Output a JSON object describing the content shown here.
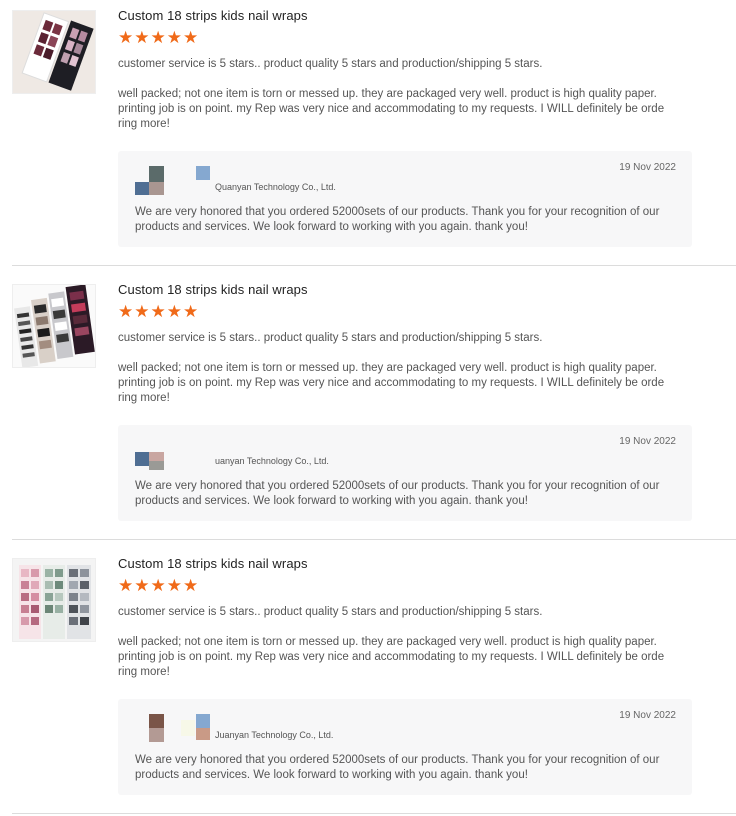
{
  "reviews": [
    {
      "product_title": "Custom 18 strips kids nail wraps",
      "rating": 5,
      "comment_line1": "customer service is 5 stars.. product quality 5 stars and production/shipping 5 stars.",
      "comment_body": "well packed; not one item is torn or messed up. they are packaged very well. product is high quality paper. printing job is on point. my Rep was very nice and accommodating to my requests. I WILL definitely be ordering more!",
      "reply": {
        "date": "19 Nov 2022",
        "company": "Quanyan Technology Co., Ltd.",
        "text": "We are very honored that you ordered 52000sets of our products. Thank you for your recognition of our products and services. We look forward to working with you again. thank you!"
      }
    },
    {
      "product_title": "Custom 18 strips kids nail wraps",
      "rating": 5,
      "comment_line1": "customer service is 5 stars.. product quality 5 stars and production/shipping 5 stars.",
      "comment_body": "well packed; not one item is torn or messed up. they are packaged very well. product is high quality paper. printing job is on point. my Rep was very nice and accommodating to my requests. I WILL definitely be ordering more!",
      "reply": {
        "date": "19 Nov 2022",
        "company": "uanyan Technology Co., Ltd.",
        "text": "We are very honored that you ordered 52000sets of our products. Thank you for your recognition of our products and services. We look forward to working with you again. thank you!"
      }
    },
    {
      "product_title": "Custom 18 strips kids nail wraps",
      "rating": 5,
      "comment_line1": "customer service is 5 stars.. product quality 5 stars and production/shipping 5 stars.",
      "comment_body": "well packed; not one item is torn or messed up. they are packaged very well. product is high quality paper. printing job is on point. my Rep was very nice and accommodating to my requests. I WILL definitely be ordering more!",
      "reply": {
        "date": "19 Nov 2022",
        "company": "Juanyan Technology Co., Ltd.",
        "text": "We are very honored that you ordered 52000sets of our products. Thank you for your recognition of our products and services. We look forward to working with you again. thank you!"
      }
    }
  ],
  "colors": {
    "star": "#f06a19",
    "reply_bg": "#f7f7f8",
    "divider": "#dcdcdc"
  },
  "icons": {
    "rating": "star-icon"
  }
}
